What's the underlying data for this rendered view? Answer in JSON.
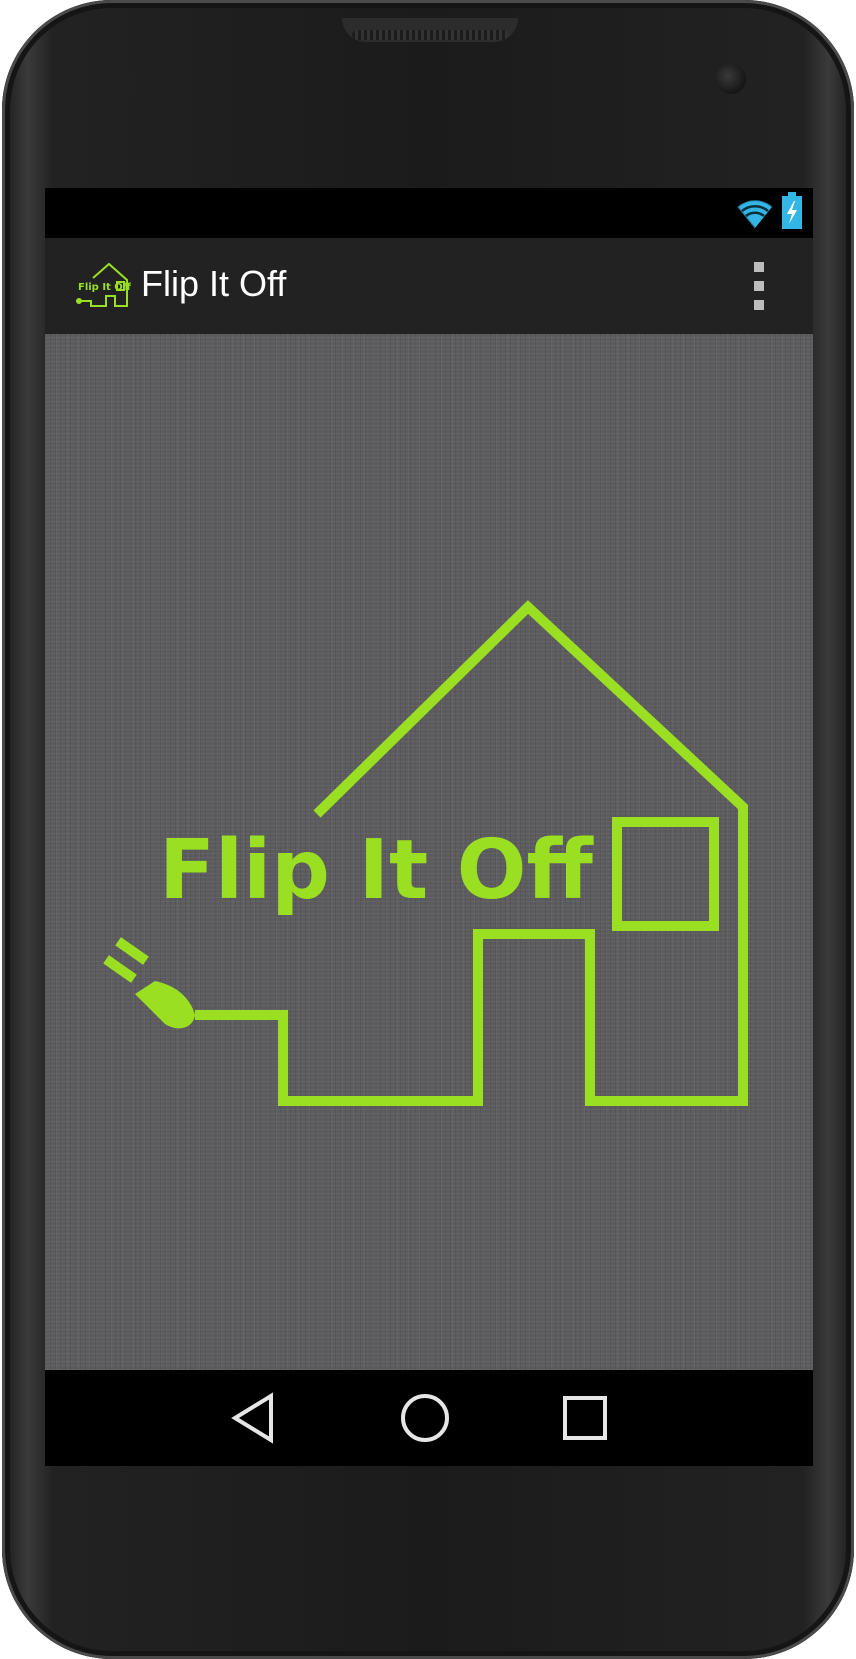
{
  "app": {
    "title": "Flip It Off",
    "accent_color": "#9ADF22",
    "icons": {
      "app": "house-plug-logo-icon",
      "menu": "overflow-menu-icon"
    }
  },
  "status_bar": {
    "icons": [
      "wifi-icon",
      "battery-charging-icon"
    ]
  },
  "splash": {
    "logo_text": "Flip It Off",
    "logo_icon": "house-plug-logo"
  },
  "navigation": {
    "buttons": [
      "back-icon",
      "home-icon",
      "recent-apps-icon"
    ]
  }
}
